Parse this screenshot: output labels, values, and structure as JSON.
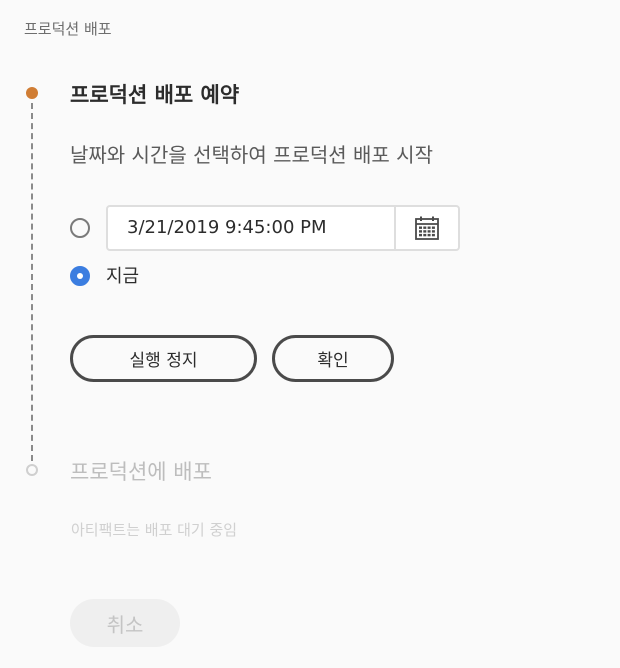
{
  "breadcrumb": "프로덕션 배포",
  "step1": {
    "title": "프로덕션 배포 예약",
    "description": "날짜와 시간을 선택하여 프로덕션 배포 시작",
    "datetime_value": "3/21/2019  9:45:00 PM",
    "now_label": "지금",
    "selected_option": "now",
    "stop_button": "실행 정지",
    "confirm_button": "확인"
  },
  "step2": {
    "title": "프로덕션에 배포",
    "description": "아티팩트는 배포 대기 중임",
    "cancel_button": "취소"
  },
  "colors": {
    "active_step": "#d07d34",
    "radio_selected": "#3b7de0",
    "disabled_text": "#bdbdbd"
  }
}
